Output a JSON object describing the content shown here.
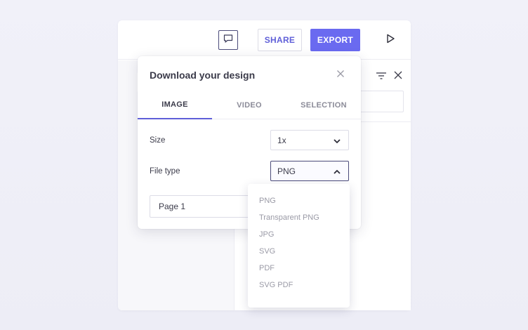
{
  "toolbar": {
    "share_label": "SHARE",
    "export_label": "EXPORT",
    "accent_color": "#6a6af0"
  },
  "icons": {
    "comment": "comment-icon",
    "play": "play-icon",
    "filter": "filter-icon",
    "close": "close-icon",
    "chevron_down": "chevron-down-icon",
    "chevron_up": "chevron-up-icon"
  },
  "modal": {
    "title": "Download your design",
    "tabs": [
      {
        "label": "IMAGE",
        "active": true
      },
      {
        "label": "VIDEO",
        "active": false
      },
      {
        "label": "SELECTION",
        "active": false
      }
    ],
    "size": {
      "label": "Size",
      "value": "1x"
    },
    "file_type": {
      "label": "File type",
      "value": "PNG"
    },
    "page_field": {
      "value": "Page 1"
    }
  },
  "dropdown": {
    "options": [
      "PNG",
      "Transparent PNG",
      "JPG",
      "SVG",
      "PDF",
      "SVG PDF"
    ]
  }
}
